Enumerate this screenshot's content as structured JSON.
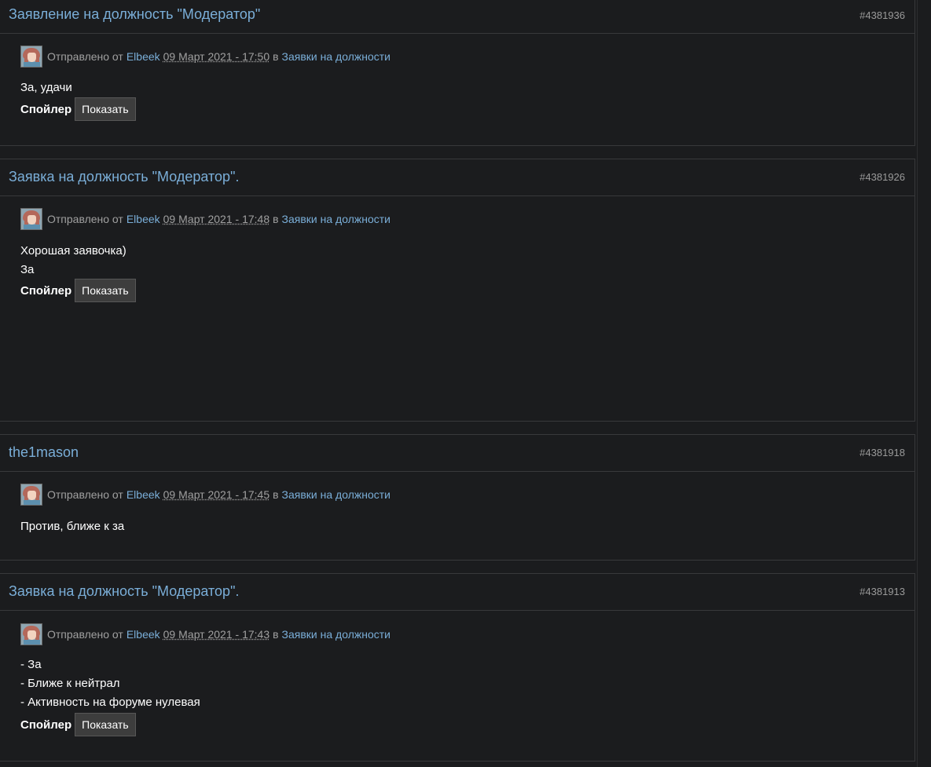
{
  "posts": [
    {
      "title": "Заявление на должность \"Модератор\"",
      "id": "#4381936",
      "sent_from": "Отправлено от",
      "author": "Elbeek",
      "date": "09 Март 2021 - 17:50",
      "in": "в",
      "forum": "Заявки на должности",
      "lines": [
        "За, удачи"
      ],
      "spoiler_label": "Спойлер",
      "show_label": "Показать"
    },
    {
      "title": "Заявка на должность \"Модератор\".",
      "id": "#4381926",
      "sent_from": "Отправлено от",
      "author": "Elbeek",
      "date": "09 Март 2021 - 17:48",
      "in": "в",
      "forum": "Заявки на должности",
      "lines": [
        "Хорошая заявочка)",
        "За"
      ],
      "spoiler_label": "Спойлер",
      "show_label": "Показать"
    },
    {
      "title": "the1mason",
      "id": "#4381918",
      "sent_from": "Отправлено от",
      "author": "Elbeek",
      "date": "09 Март 2021 - 17:45",
      "in": "в",
      "forum": "Заявки на должности",
      "lines": [
        "Против, ближе к за"
      ]
    },
    {
      "title": "Заявка на должность \"Модератор\".",
      "id": "#4381913",
      "sent_from": "Отправлено от",
      "author": "Elbeek",
      "date": "09 Март 2021 - 17:43",
      "in": "в",
      "forum": "Заявки на должности",
      "lines": [
        "- За",
        "- Ближе к нейтрал",
        "- Активность на форуме нулевая"
      ],
      "spoiler_label": "Спойлер",
      "show_label": "Показать"
    }
  ]
}
